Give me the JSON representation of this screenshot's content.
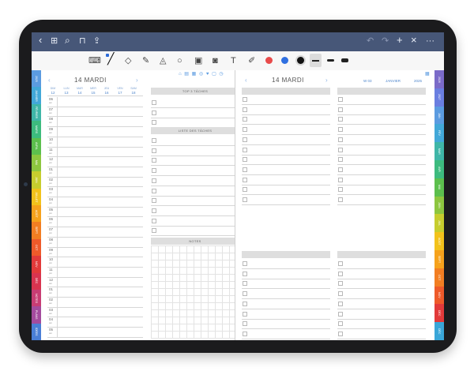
{
  "topbar": {
    "back_icon": "chevron-left",
    "icons": [
      "grid-icon",
      "search-icon",
      "bookmark-icon",
      "share-icon"
    ],
    "right_icons": [
      "undo-icon",
      "redo-icon",
      "plus-icon",
      "close-icon",
      "more-icon"
    ],
    "back": "‹",
    "grid": "⊞",
    "search": "⌕",
    "bookmark": "⊓",
    "share": "⇪",
    "undo": "↶",
    "redo": "↷",
    "plus": "+",
    "close": "×",
    "more": "···"
  },
  "toolbar": {
    "tools": [
      "keyboard-icon",
      "pen-icon",
      "eraser-icon",
      "highlighter-icon",
      "shapes-icon",
      "lasso-icon",
      "image-icon",
      "camera-icon",
      "text-icon",
      "pointer-icon"
    ],
    "colors": [
      "#e84a4a",
      "#2f6fe0",
      "#111111"
    ],
    "stroke_sizes": [
      "thin",
      "medium",
      "thick"
    ]
  },
  "left_tabs": [
    {
      "label": "2025",
      "color": "#5b9be0"
    },
    {
      "label": "JANVIER",
      "color": "#42a8d8"
    },
    {
      "label": "FÉVRIER",
      "color": "#3fb6a8"
    },
    {
      "label": "MARS",
      "color": "#3dbb7e"
    },
    {
      "label": "AVRIL",
      "color": "#5cbf4d"
    },
    {
      "label": "MAI",
      "color": "#8dc63f"
    },
    {
      "label": "JUIN",
      "color": "#c6cd2e"
    },
    {
      "label": "JUILLET",
      "color": "#f2c21b"
    },
    {
      "label": "AOÛT",
      "color": "#f6a21c"
    },
    {
      "label": "SEPT",
      "color": "#f27e22"
    },
    {
      "label": "OCT",
      "color": "#ee5a2a"
    },
    {
      "label": "NOV",
      "color": "#e23a3a"
    },
    {
      "label": "DÉC",
      "color": "#d9344f"
    },
    {
      "label": "NOTES",
      "color": "#c83d74"
    },
    {
      "label": "PLANS",
      "color": "#a44b9e"
    },
    {
      "label": "IDÉES",
      "color": "#4a7fd6"
    }
  ],
  "right_tabs": [
    {
      "label": "2026",
      "color": "#7b6bc8"
    },
    {
      "label": "2027",
      "color": "#6a7ee0"
    },
    {
      "label": "JAN",
      "color": "#5b9be0"
    },
    {
      "label": "FÉV",
      "color": "#42a8d8"
    },
    {
      "label": "MAR",
      "color": "#3fb6a8"
    },
    {
      "label": "AVR",
      "color": "#3dbb7e"
    },
    {
      "label": "MAI",
      "color": "#5cbf4d"
    },
    {
      "label": "JUIN",
      "color": "#8dc63f"
    },
    {
      "label": "JUIL",
      "color": "#c6cd2e"
    },
    {
      "label": "AOÛT",
      "color": "#f2c21b"
    },
    {
      "label": "SEPT",
      "color": "#f6a21c"
    },
    {
      "label": "OCT",
      "color": "#f27e22"
    },
    {
      "label": "NOV",
      "color": "#ee5a2a"
    },
    {
      "label": "DÉC",
      "color": "#e23a3a"
    },
    {
      "label": "DÉC",
      "color": "#3aa6d8"
    }
  ],
  "left_page": {
    "day_title": "14 MARDI",
    "prev": "‹",
    "next": "›",
    "week_days": [
      "DIM",
      "LUN",
      "MAR",
      "MER",
      "JEU",
      "VEN",
      "SAM"
    ],
    "week_dates": [
      "12",
      "13",
      "14",
      "15",
      "16",
      "17",
      "18"
    ],
    "hours": [
      "06",
      "07",
      "08",
      "09",
      "10",
      "11",
      "12",
      "01",
      "02",
      "03",
      "04",
      "05",
      "06",
      "07",
      "08",
      "09",
      "10",
      "11",
      "12",
      "01",
      "02",
      "03",
      "04",
      "05"
    ],
    "ampm": [
      "am",
      "am",
      "am",
      "am",
      "am",
      "am",
      "pm",
      "pm",
      "pm",
      "pm",
      "pm",
      "pm",
      "pm",
      "pm",
      "pm",
      "pm",
      "pm",
      "pm",
      "am",
      "am",
      "am",
      "am",
      "am",
      "am"
    ],
    "top3_label": "TOP 3 TÂCHES",
    "tasks_label": "LISTE DES TÂCHES",
    "notes_label": "NOTES",
    "top_icons": "⌂ ▤ ▦ ◎ ♥ ▢ ◷"
  },
  "right_page": {
    "day_title": "14 MARDI",
    "prev": "‹",
    "next": "›",
    "week_label": "W 03",
    "month_label": "JANVIER",
    "year_label": "2025",
    "corner_icon": "▦"
  }
}
